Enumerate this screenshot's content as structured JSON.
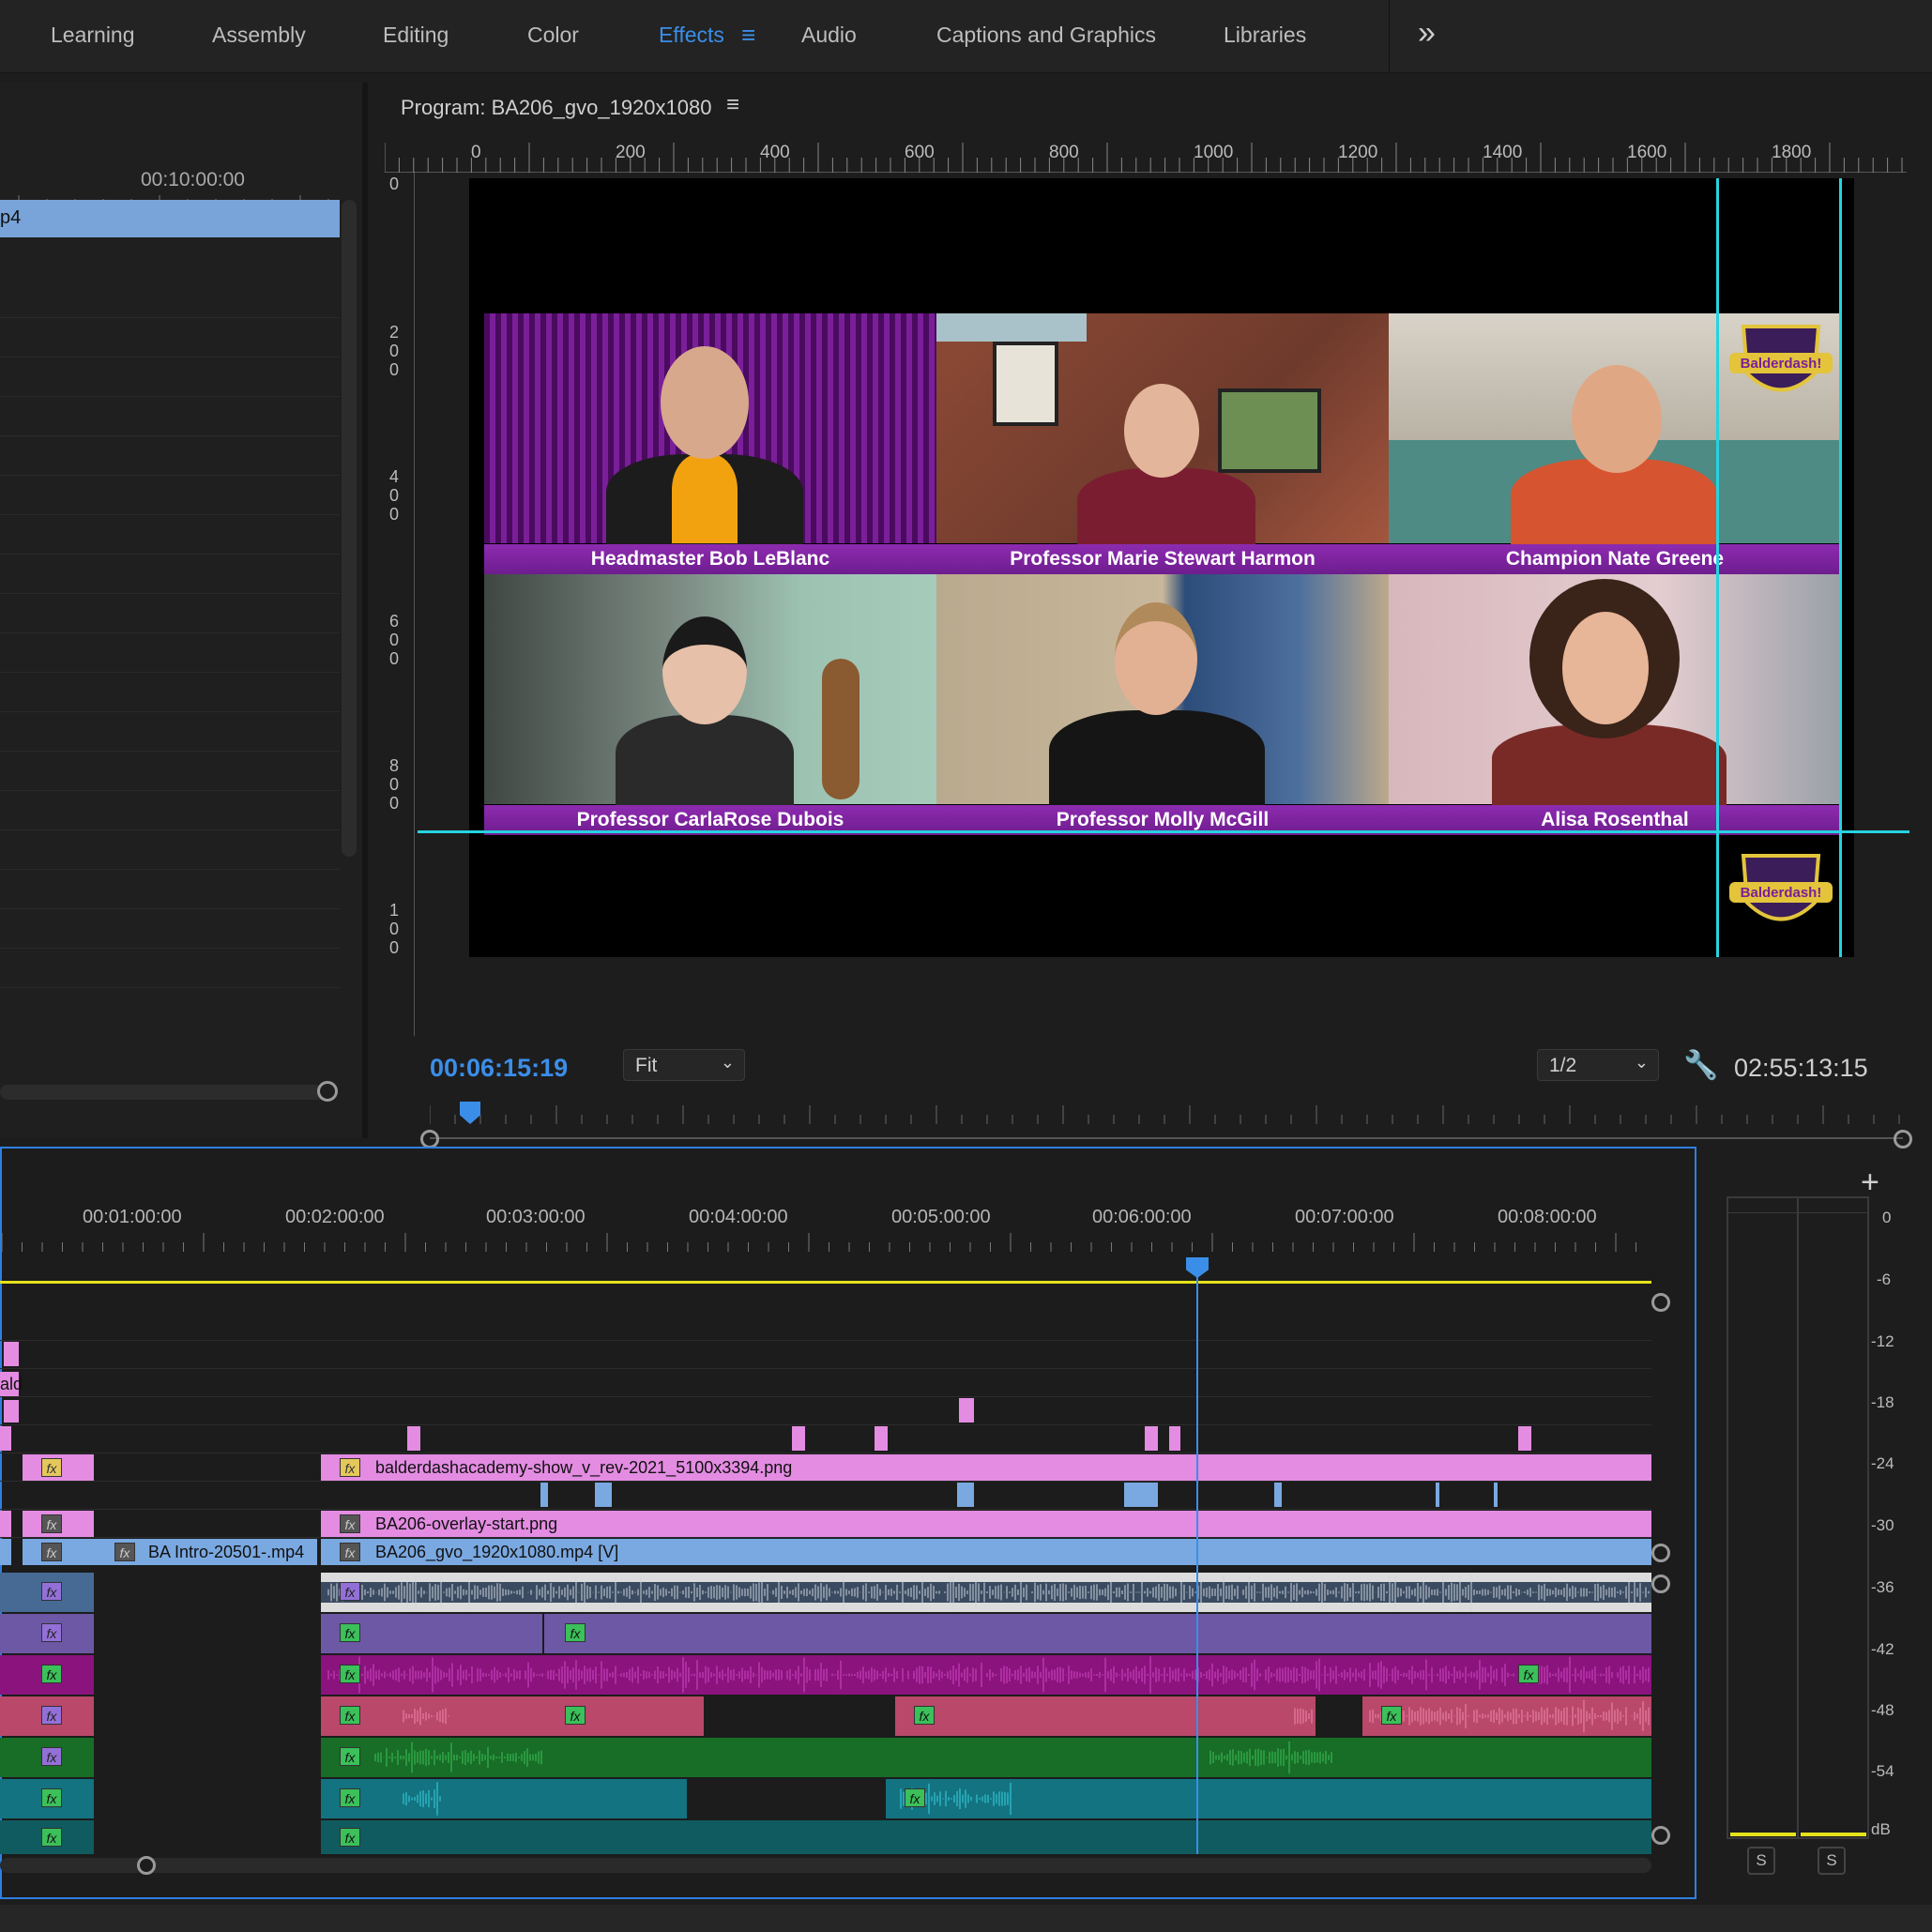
{
  "workspace_tabs": [
    {
      "label": "Learning"
    },
    {
      "label": "Assembly"
    },
    {
      "label": "Editing"
    },
    {
      "label": "Color"
    },
    {
      "label": "Effects",
      "active": true
    },
    {
      "label": "Audio"
    },
    {
      "label": "Captions and Graphics"
    },
    {
      "label": "Libraries"
    }
  ],
  "source_panel": {
    "ruler_time": "00:10:00:00",
    "clip_label": "p4"
  },
  "program_monitor": {
    "title": "Program: BA206_gvo_1920x1080",
    "h_ruler": [
      "0",
      "200",
      "400",
      "600",
      "800",
      "1000",
      "1200",
      "1400",
      "1600",
      "1800"
    ],
    "v_ruler": [
      "0",
      "2\n0\n0",
      "4\n0\n0",
      "6\n0\n0",
      "8\n0\n0",
      "1\n0\n0"
    ],
    "participants": [
      "Headmaster Bob LeBlanc",
      "Professor Marie Stewart Harmon",
      "Champion Nate Greene",
      "Professor CarlaRose Dubois",
      "Professor Molly McGill",
      "Alisa Rosenthal"
    ],
    "current_time": "00:06:15:19",
    "zoom": "Fit",
    "resolution": "1/2",
    "duration": "02:55:13:15",
    "logo_text": "Balderdash!"
  },
  "timeline": {
    "ruler": [
      "00:01:00:00",
      "00:02:00:00",
      "00:03:00:00",
      "00:04:00:00",
      "00:05:00:00",
      "00:06:00:00",
      "00:07:00:00",
      "00:08:00:00"
    ],
    "clips": {
      "bg_image": "balderdashacademy-show_v_rev-2021_5100x3394.png",
      "overlay": "BA206-overlay-start.png",
      "intro": "BA Intro-20501-.mp4",
      "main": "BA206_gvo_1920x1080.mp4 [V]",
      "left_cut": "ald"
    }
  },
  "audio_meter": {
    "db_scale": [
      "0",
      "-6",
      "-12",
      "-18",
      "-24",
      "-30",
      "-36",
      "-42",
      "-48",
      "-54",
      "dB"
    ],
    "solo_labels": [
      "S",
      "S"
    ]
  },
  "colors": {
    "accent": "#3b8ee8",
    "guide": "#26d3e0",
    "clip_pink": "#e38ce2",
    "clip_blue": "#7aa8e0",
    "nameplate": "#7a21a0"
  }
}
